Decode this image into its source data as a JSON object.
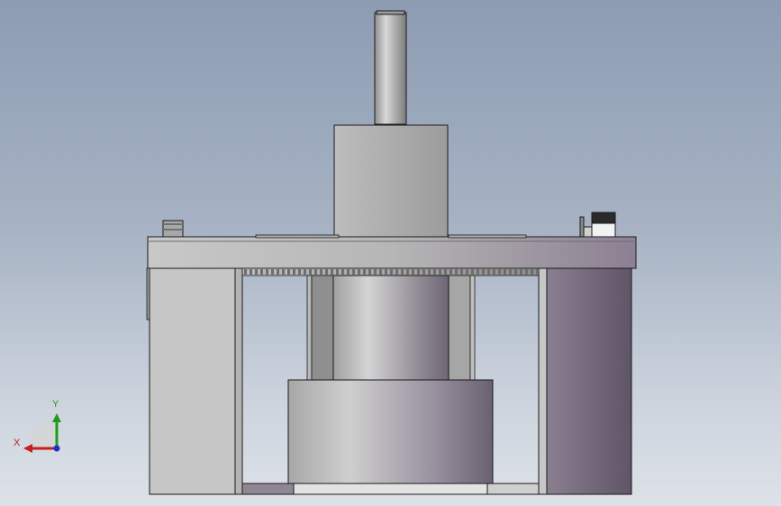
{
  "triad": {
    "x_label": "X",
    "y_label": "Y",
    "x_color": "#c81e1e",
    "y_color": "#1e9a1e",
    "z_color": "#1e2fc8"
  },
  "colors": {
    "background_top": "#8d9cb3",
    "background_bottom": "#dde2e8",
    "outline": "#1a1a1a"
  }
}
